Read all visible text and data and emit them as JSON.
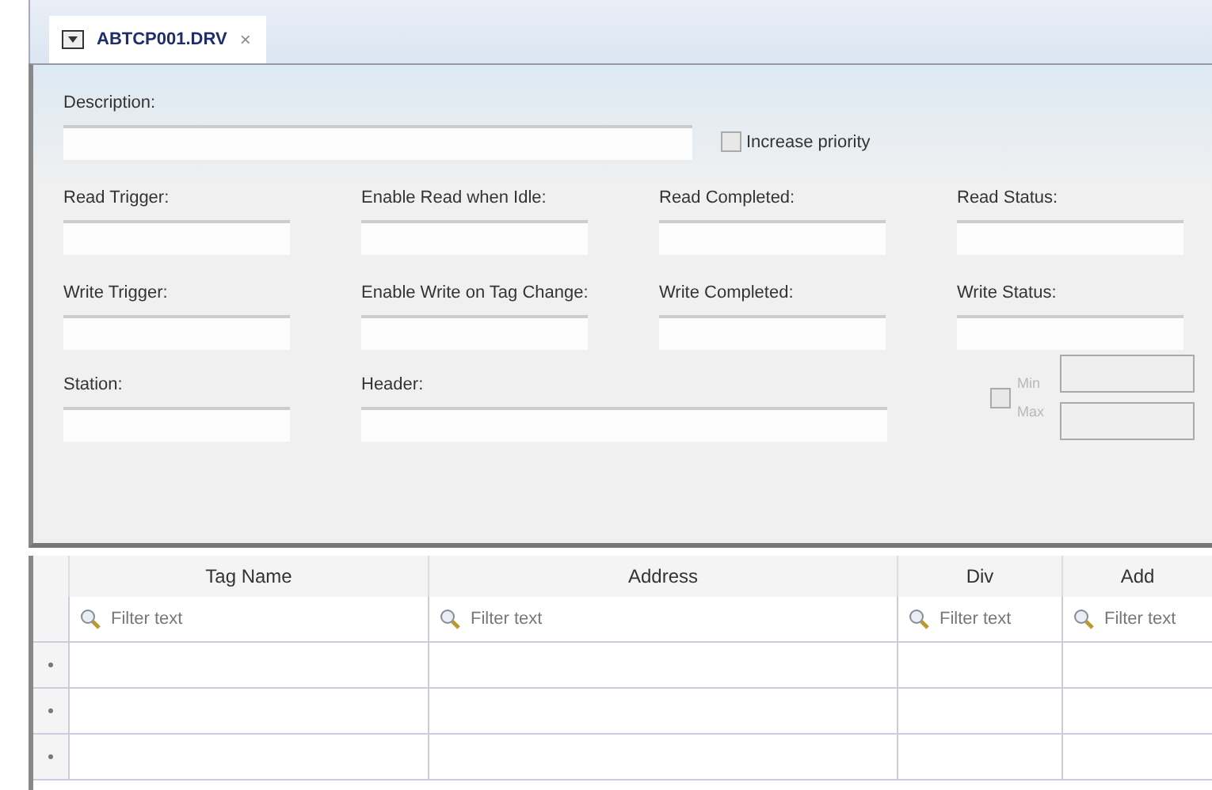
{
  "tabs": [
    {
      "title": "ABTCP001.DRV",
      "close": "×",
      "selected": true
    }
  ],
  "description": {
    "label": "Description:"
  },
  "increase_priority": {
    "label": "Increase priority",
    "checked": false
  },
  "field_rows": [
    {
      "fields": [
        {
          "label": "Read Trigger:"
        },
        {
          "label": "Enable Read when Idle:"
        },
        {
          "label": "Read Completed:"
        },
        {
          "label": "Read Status:"
        }
      ]
    },
    {
      "fields": [
        {
          "label": "Write Trigger:"
        },
        {
          "label": "Enable Write on Tag Change:"
        },
        {
          "label": "Write Completed:"
        },
        {
          "label": "Write Status:"
        }
      ]
    }
  ],
  "station": {
    "label": "Station:"
  },
  "header": {
    "label": "Header:"
  },
  "range": {
    "checked": false,
    "disabled": true,
    "min_label": "Min",
    "max_label": "Max"
  },
  "table": {
    "columns": [
      {
        "title": "Tag Name",
        "filter_placeholder": "Filter text"
      },
      {
        "title": "Address",
        "filter_placeholder": "Filter text"
      },
      {
        "title": "Div",
        "filter_placeholder": "Filter text"
      },
      {
        "title": "Add",
        "filter_placeholder": "Filter text"
      }
    ],
    "rows": [
      {
        "kind": "blank"
      },
      {
        "kind": "blank"
      },
      {
        "kind": "blank"
      }
    ]
  }
}
